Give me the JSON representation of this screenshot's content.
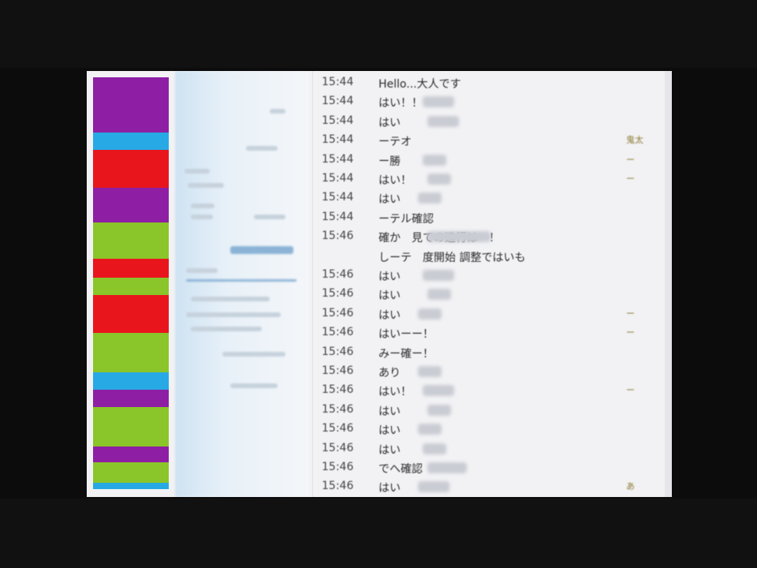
{
  "strip_bands": [
    {
      "color": "#8e1fa4",
      "h": 70
    },
    {
      "color": "#27a9e5",
      "h": 22
    },
    {
      "color": "#e8151d",
      "h": 48
    },
    {
      "color": "#8e1fa4",
      "h": 44
    },
    {
      "color": "#8ac52a",
      "h": 46
    },
    {
      "color": "#e8151d",
      "h": 24
    },
    {
      "color": "#8ac52a",
      "h": 22
    },
    {
      "color": "#e8151d",
      "h": 48
    },
    {
      "color": "#8ac52a",
      "h": 50
    },
    {
      "color": "#27a9e5",
      "h": 22
    },
    {
      "color": "#8e1fa4",
      "h": 22
    },
    {
      "color": "#8ac52a",
      "h": 50
    },
    {
      "color": "#8e1fa4",
      "h": 20
    },
    {
      "color": "#8ac52a",
      "h": 26
    },
    {
      "color": "#27a9e5",
      "h": 8
    }
  ],
  "chat_rows": [
    {
      "time": "15:44",
      "msg": "Hello...大人です",
      "smudge": 0
    },
    {
      "time": "15:44",
      "msg": "はい！！",
      "smudge": 40
    },
    {
      "time": "15:44",
      "msg": "はい",
      "smudge": 40
    },
    {
      "time": "15:44",
      "msg": "ーテオ",
      "smudge": 0
    },
    {
      "time": "15:44",
      "msg": "ー勝",
      "smudge": 30
    },
    {
      "time": "15:44",
      "msg": "はい！",
      "smudge": 30
    },
    {
      "time": "15:44",
      "msg": "はい",
      "smudge": 30
    },
    {
      "time": "15:44",
      "msg": "ーテル確認",
      "smudge": 0
    },
    {
      "time": "15:46",
      "msg": "確か　見ての進行は一！",
      "smudge": 80
    },
    {
      "time": "",
      "msg": "しーテ　度開始 調整ではいも",
      "smudge": 0
    },
    {
      "time": "15:46",
      "msg": "はい",
      "smudge": 40
    },
    {
      "time": "15:46",
      "msg": "はい",
      "smudge": 30
    },
    {
      "time": "15:46",
      "msg": "はい",
      "smudge": 30
    },
    {
      "time": "15:46",
      "msg": "はいーー！",
      "smudge": 0
    },
    {
      "time": "15:46",
      "msg": "みー確ー！",
      "smudge": 0
    },
    {
      "time": "15:46",
      "msg": "あり",
      "smudge": 30
    },
    {
      "time": "15:46",
      "msg": "はい！",
      "smudge": 40
    },
    {
      "time": "15:46",
      "msg": "はい",
      "smudge": 30
    },
    {
      "time": "15:46",
      "msg": "はい",
      "smudge": 30
    },
    {
      "time": "15:46",
      "msg": "はい",
      "smudge": 30
    },
    {
      "time": "15:46",
      "msg": "でへ確認",
      "smudge": 50
    },
    {
      "time": "15:46",
      "msg": "はい",
      "smudge": 40
    }
  ],
  "right_marks": [
    {
      "text": "鬼太",
      "row": 3
    },
    {
      "text": "ー",
      "row": 4
    },
    {
      "text": "ー",
      "row": 5
    },
    {
      "text": "ー",
      "row": 12
    },
    {
      "text": "ー",
      "row": 13
    },
    {
      "text": "ー",
      "row": 16
    },
    {
      "text": "あ",
      "row": 21
    }
  ]
}
